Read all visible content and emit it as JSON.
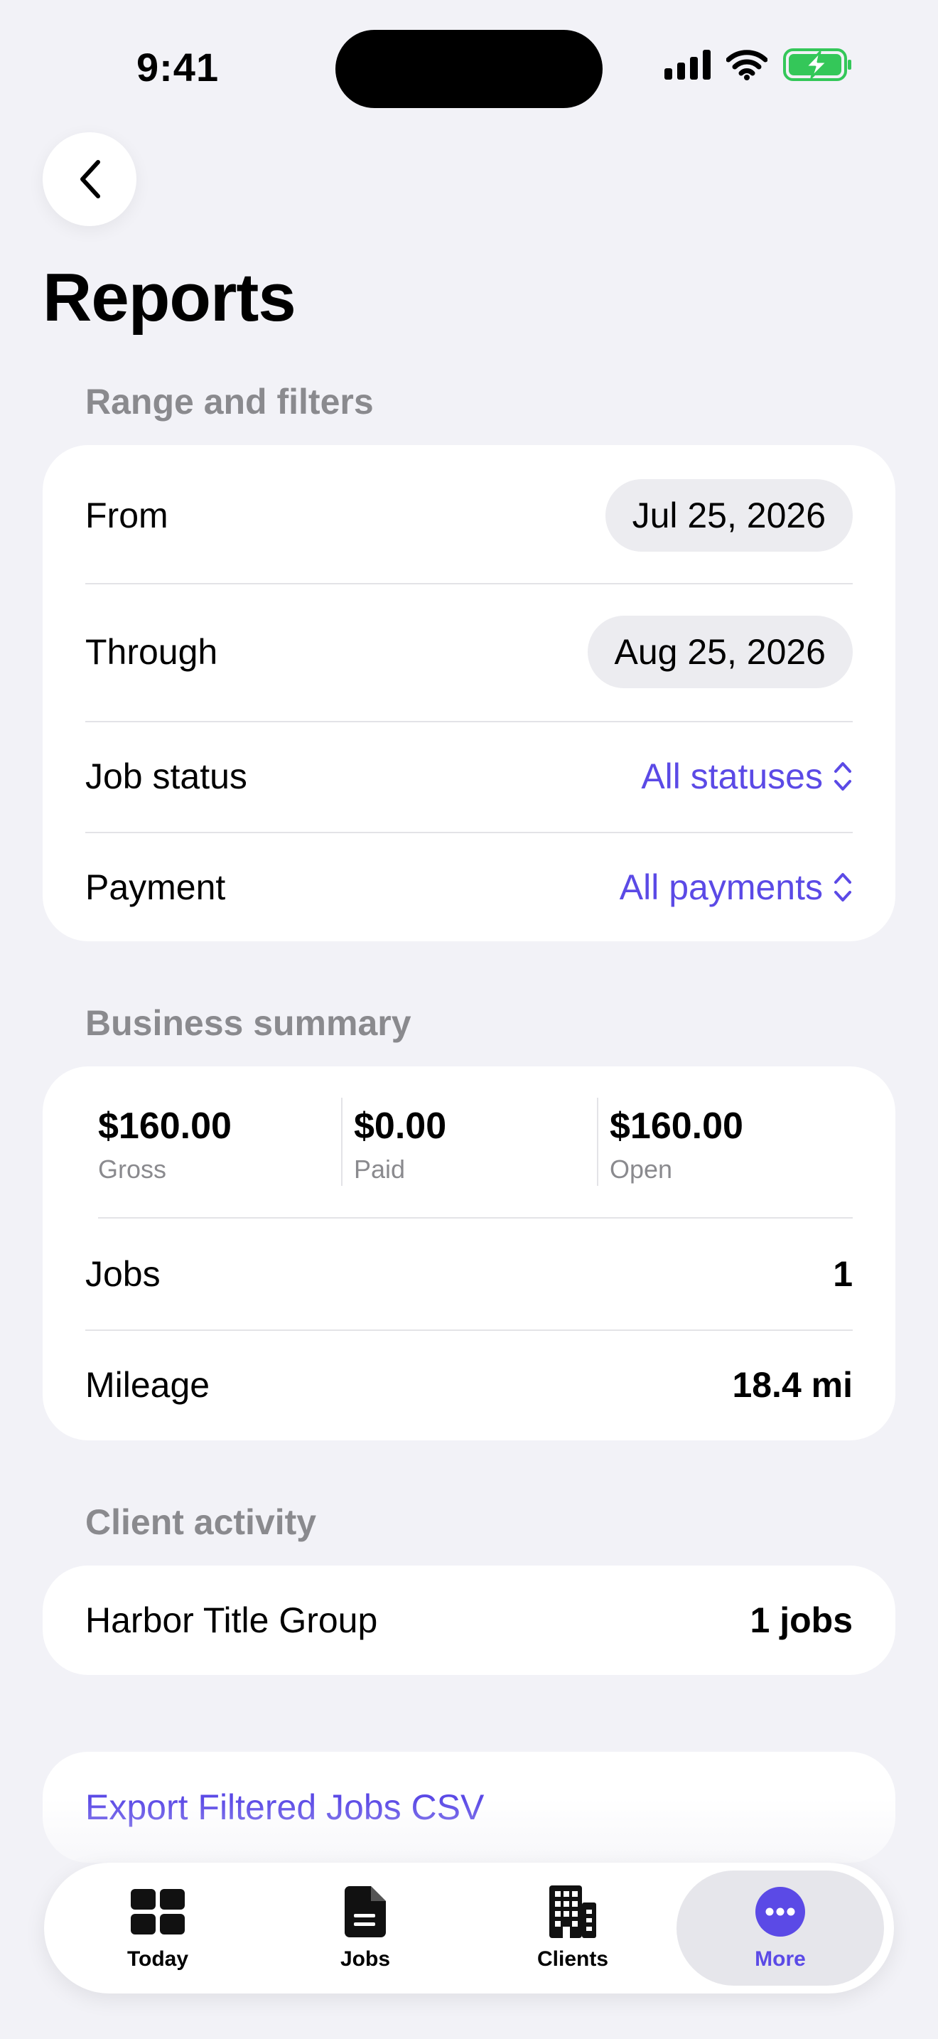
{
  "status_bar": {
    "time": "9:41"
  },
  "header": {
    "title": "Reports"
  },
  "filters": {
    "section_title": "Range and filters",
    "from_label": "From",
    "from_value": "Jul 25, 2026",
    "through_label": "Through",
    "through_value": "Aug 25, 2026",
    "job_status_label": "Job status",
    "job_status_value": "All statuses",
    "payment_label": "Payment",
    "payment_value": "All payments"
  },
  "summary": {
    "section_title": "Business summary",
    "stats": [
      {
        "value": "$160.00",
        "label": "Gross"
      },
      {
        "value": "$0.00",
        "label": "Paid"
      },
      {
        "value": "$160.00",
        "label": "Open"
      }
    ],
    "jobs_label": "Jobs",
    "jobs_value": "1",
    "mileage_label": "Mileage",
    "mileage_value": "18.4 mi"
  },
  "client_activity": {
    "section_title": "Client activity",
    "clients": [
      {
        "name": "Harbor Title Group",
        "count": "1 jobs"
      }
    ]
  },
  "export": {
    "label": "Export Filtered Jobs CSV"
  },
  "tab_bar": {
    "tabs": [
      {
        "label": "Today",
        "icon": "grid-icon"
      },
      {
        "label": "Jobs",
        "icon": "document-icon"
      },
      {
        "label": "Clients",
        "icon": "building-icon"
      },
      {
        "label": "More",
        "icon": "ellipsis-icon"
      }
    ],
    "active": "More"
  },
  "colors": {
    "accent": "#5b4ae6",
    "background": "#f2f2f7",
    "secondary_text": "#8a8a8e",
    "battery_green": "#34c759"
  }
}
